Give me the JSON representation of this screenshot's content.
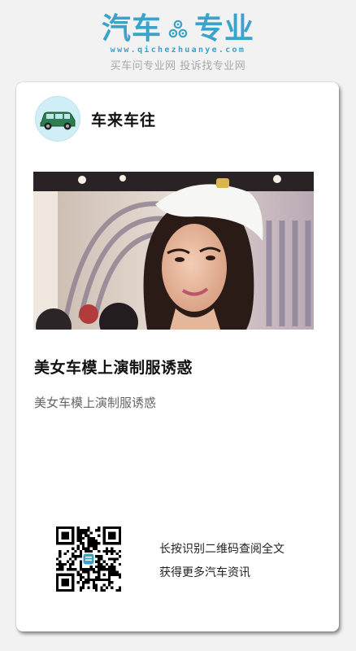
{
  "brand": {
    "logo_left": "汽车",
    "logo_right": "专业",
    "logo_icon": "gear-icon",
    "url": "www.qichezhuanye.com",
    "tagline": "买车问专业网 投诉找专业网",
    "color": "#3aa3c9"
  },
  "author": {
    "name": "车来车往",
    "avatar_icon": "car-avatar-icon"
  },
  "article": {
    "title": "美女车模上演制服诱惑",
    "summary": "美女车模上演制服诱惑"
  },
  "qr": {
    "line1": "长按识别二维码查阅全文",
    "line2": "获得更多汽车资讯"
  }
}
